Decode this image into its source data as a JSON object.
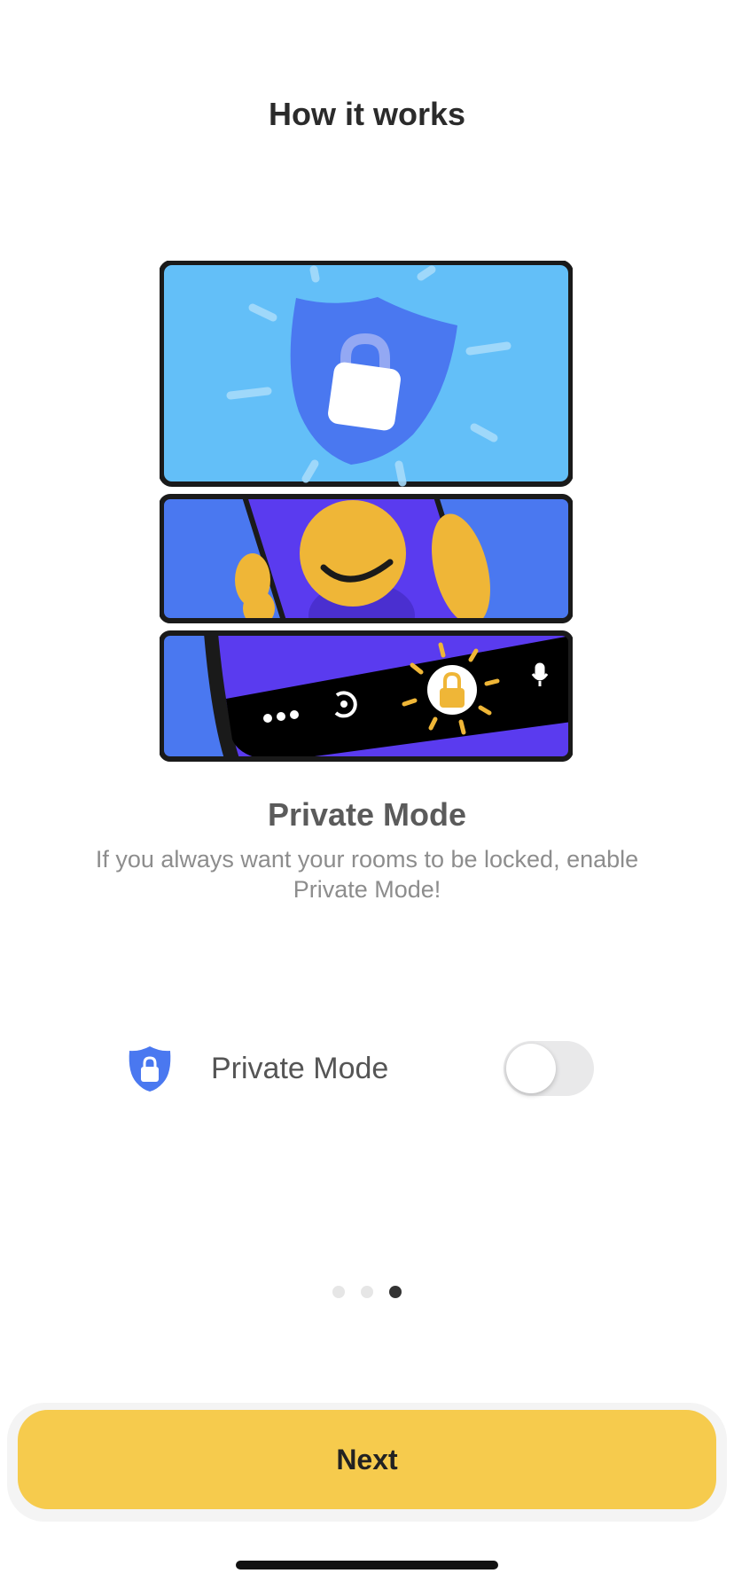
{
  "header": {
    "title": "How it works"
  },
  "info": {
    "title": "Private Mode",
    "description": "If you always want your rooms to be locked, enable Private Mode!"
  },
  "setting": {
    "label": "Private Mode",
    "enabled": false
  },
  "pagination": {
    "total": 3,
    "current": 3
  },
  "footer": {
    "next_label": "Next"
  },
  "colors": {
    "accent": "#f6cb4d",
    "shield_blue": "#4a78f0",
    "sky_blue": "#63bff8",
    "purple": "#5a3bef",
    "face_yellow": "#efb637"
  }
}
